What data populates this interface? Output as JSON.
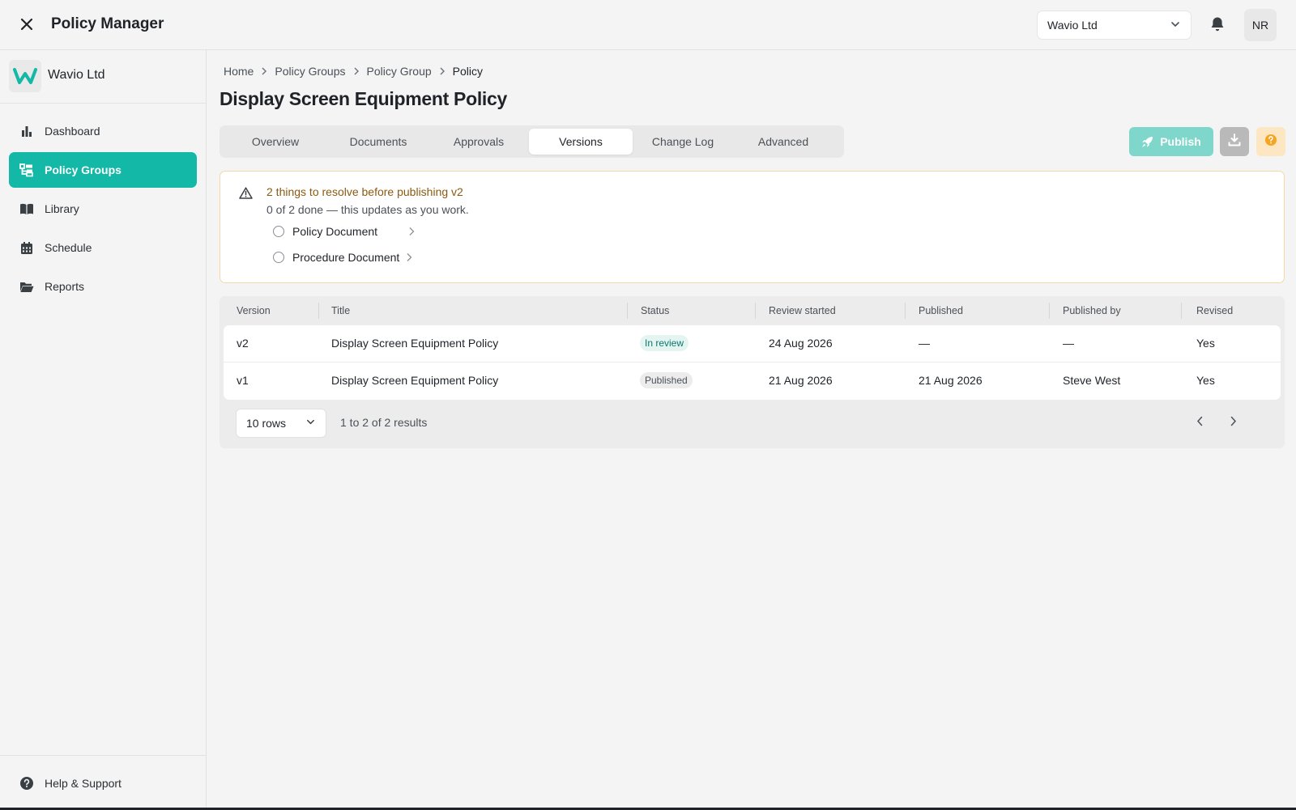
{
  "app": {
    "title": "Policy Manager"
  },
  "topbar": {
    "org_select": "Wavio Ltd",
    "avatar_initials": "NR"
  },
  "sidebar": {
    "org_name": "Wavio Ltd",
    "items": [
      {
        "label": "Dashboard",
        "icon": "bar-chart-icon",
        "active": false
      },
      {
        "label": "Policy Groups",
        "icon": "hierarchy-icon",
        "active": true
      },
      {
        "label": "Library",
        "icon": "book-icon",
        "active": false
      },
      {
        "label": "Schedule",
        "icon": "calendar-icon",
        "active": false
      },
      {
        "label": "Reports",
        "icon": "folder-icon",
        "active": false
      }
    ],
    "help_label": "Help & Support"
  },
  "breadcrumb": [
    "Home",
    "Policy Groups",
    "Policy Group",
    "Policy"
  ],
  "page": {
    "title": "Display Screen Equipment Policy"
  },
  "tabs": [
    {
      "label": "Overview",
      "active": false
    },
    {
      "label": "Documents",
      "active": false
    },
    {
      "label": "Approvals",
      "active": false
    },
    {
      "label": "Versions",
      "active": true
    },
    {
      "label": "Change Log",
      "active": false
    },
    {
      "label": "Advanced",
      "active": false
    }
  ],
  "actions": {
    "publish_label": "Publish"
  },
  "alert": {
    "title": "2 things to resolve before publishing v2",
    "subtitle": "0 of 2 done — this updates as you work.",
    "items": [
      "Policy Document",
      "Procedure Document"
    ]
  },
  "table": {
    "columns": [
      "Version",
      "Title",
      "Status",
      "Review started",
      "Published",
      "Published by",
      "Revised"
    ],
    "rows": [
      {
        "version": "v2",
        "title": "Display Screen Equipment Policy",
        "status": "In review",
        "review_started": "24 Aug 2026",
        "published": "—",
        "published_by": "—",
        "revised": "Yes"
      },
      {
        "version": "v1",
        "title": "Display Screen Equipment Policy",
        "status": "Published",
        "review_started": "21 Aug 2026",
        "published": "21 Aug 2026",
        "published_by": "Steve West",
        "revised": "Yes"
      }
    ]
  },
  "pagination": {
    "rows_select": "10 rows",
    "results_text": "1 to 2 of 2 results"
  },
  "colors": {
    "accent": "#14b8a6",
    "publish_disabled": "#7fd6cb",
    "warning_text": "#8a5a12",
    "warning_border": "#f5d8a8"
  }
}
